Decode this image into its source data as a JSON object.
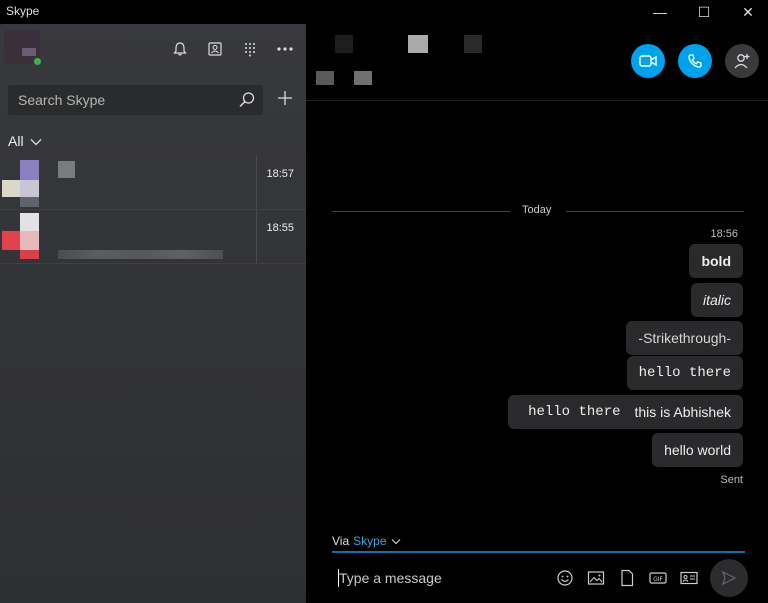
{
  "app": {
    "title": "Skype"
  },
  "window": {
    "minimize": "—",
    "maximize": "☐",
    "close": "✕"
  },
  "sidebar": {
    "search_placeholder": "Search Skype",
    "filter_label": "All",
    "conversations": [
      {
        "time": "18:57"
      },
      {
        "time": "18:55"
      }
    ]
  },
  "chat": {
    "day_separator": "Today",
    "message_time": "18:56",
    "messages": [
      {
        "text": "bold",
        "style": "bold"
      },
      {
        "text": "italic",
        "style": "italic"
      },
      {
        "text": "-Strikethrough-",
        "style": "plain"
      },
      {
        "text": "hello there",
        "style": "mono"
      },
      {
        "mono_part": "hello there",
        "text_part": "this is Abhishek",
        "style": "mixed"
      },
      {
        "text": "hello world",
        "style": "plain"
      }
    ],
    "status": "Sent",
    "via_prefix": "Via",
    "via_app": "Skype",
    "compose_placeholder": "Type a message"
  },
  "colors": {
    "accent": "#00a2ed",
    "presence": "#3bb44a",
    "link": "#3aa4e0"
  }
}
